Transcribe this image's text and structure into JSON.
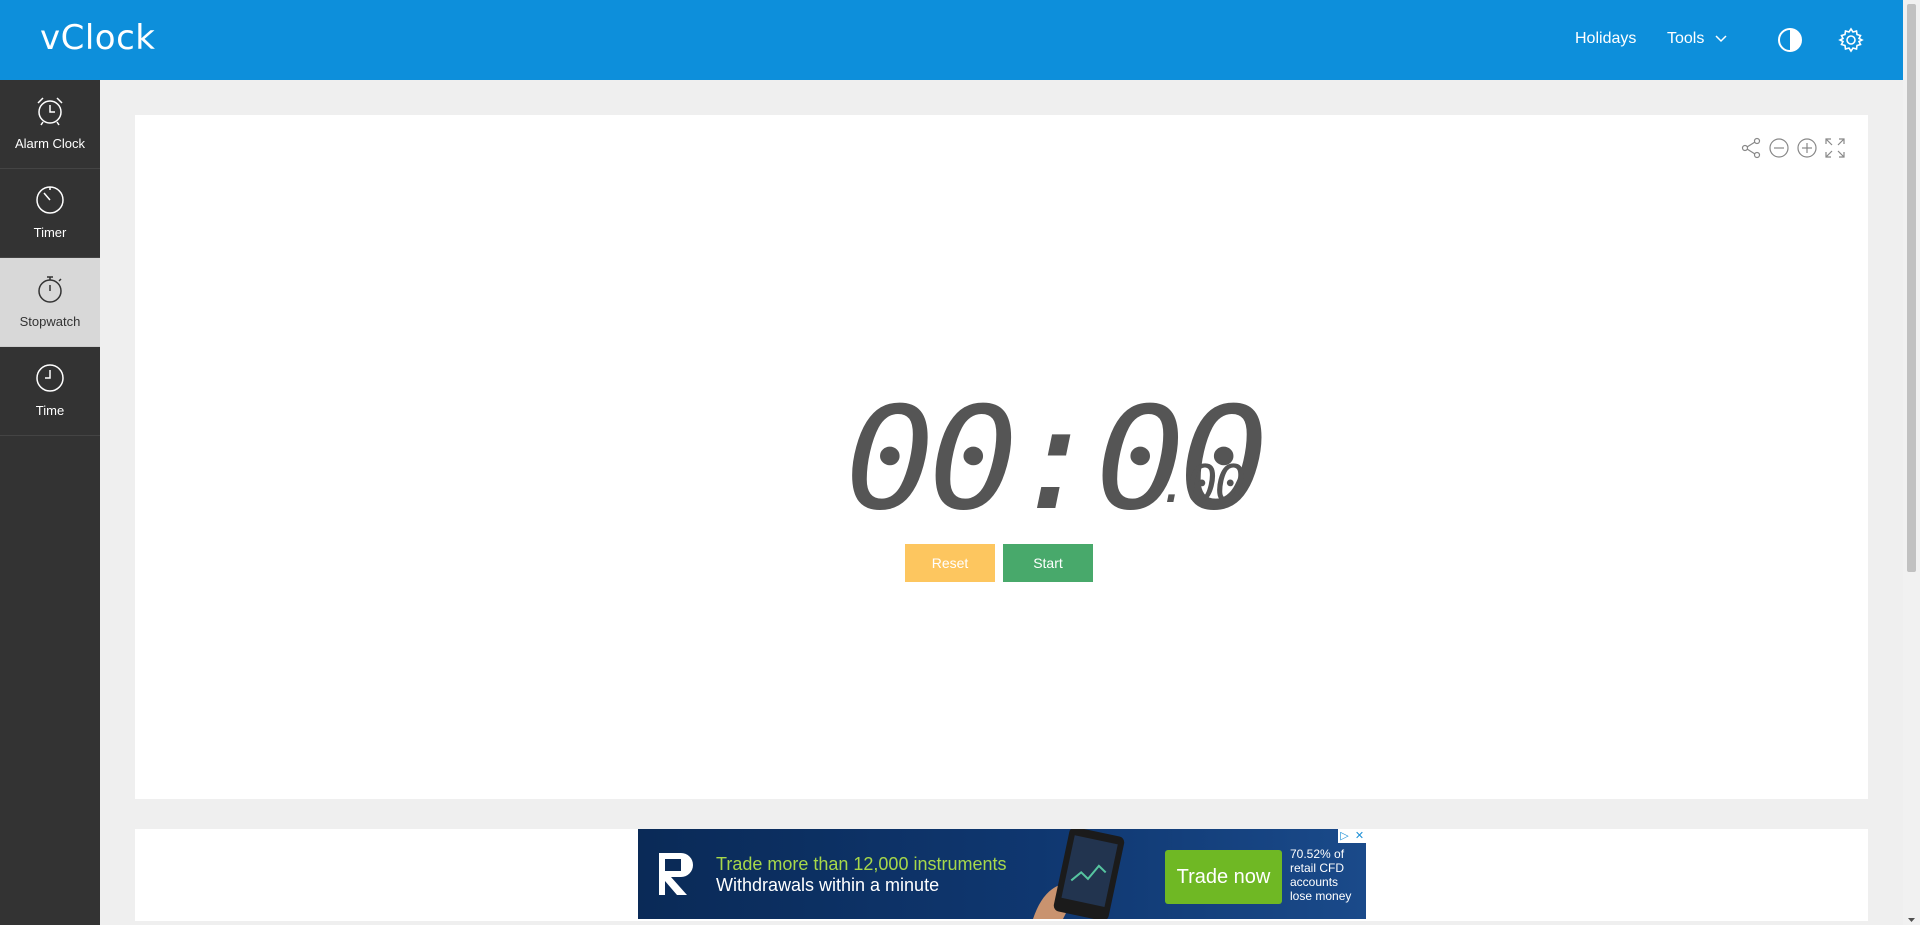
{
  "header": {
    "logo": "vClock",
    "nav": {
      "holidays": "Holidays",
      "tools": "Tools"
    },
    "icons": {
      "theme": "contrast-icon",
      "settings": "gear-icon"
    },
    "colors": {
      "bar": "#0d8fdb"
    }
  },
  "sidebar": {
    "items": [
      {
        "label": "Alarm Clock",
        "icon": "alarm-clock-icon",
        "active": false
      },
      {
        "label": "Timer",
        "icon": "timer-icon",
        "active": false
      },
      {
        "label": "Stopwatch",
        "icon": "stopwatch-icon",
        "active": true
      },
      {
        "label": "Time",
        "icon": "clock-icon",
        "active": false
      }
    ]
  },
  "stopwatch": {
    "time_main": "00:00",
    "time_hundredths": ".00",
    "reset_label": "Reset",
    "start_label": "Start",
    "tools": [
      "share-icon",
      "zoom-out-icon",
      "zoom-in-icon",
      "fullscreen-icon"
    ],
    "colors": {
      "reset": "#fdc65f",
      "start": "#48a96b"
    }
  },
  "ad": {
    "line1": "Trade more than 12,000 instruments",
    "line2": "Withdrawals within a minute",
    "cta": "Trade now",
    "disclaimer": "70.52% of retail CFD accounts lose money",
    "adchoices": "▷",
    "close": "✕"
  }
}
